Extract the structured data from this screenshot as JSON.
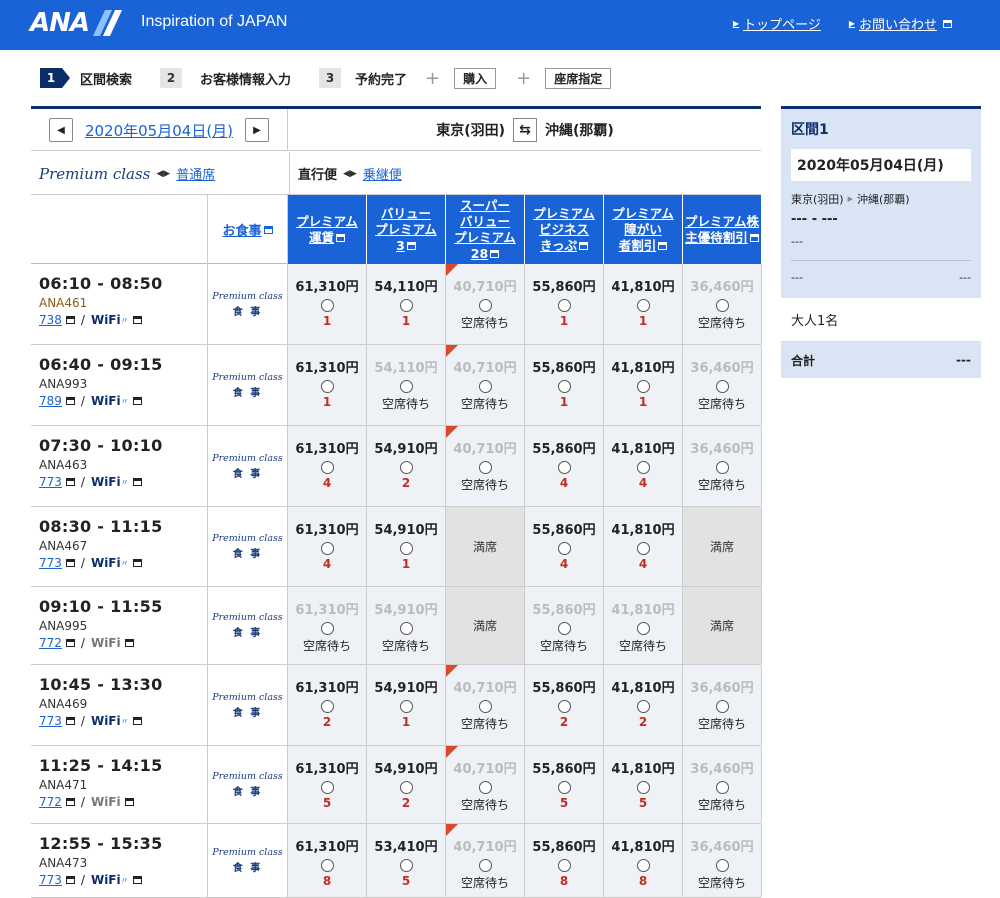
{
  "header": {
    "logo": "ANA",
    "tagline": "Inspiration of JAPAN",
    "links": [
      "トップページ",
      "お問い合わせ"
    ]
  },
  "steps": [
    {
      "num": "1",
      "label": "区間検索"
    },
    {
      "num": "2",
      "label": "お客様情報入力"
    },
    {
      "num": "3",
      "label": "予約完了"
    }
  ],
  "step_boxes": [
    "購入",
    "座席指定"
  ],
  "search": {
    "date": "2020年05月04日(月)",
    "from": "東京(羽田)",
    "to": "沖縄(那覇)",
    "premium_label": "Premium class",
    "normal_seat_link": "普通席",
    "direct": "直行便",
    "connecting_link": "乗継便"
  },
  "table_header": {
    "meal": "お食事",
    "fares": [
      [
        "プレミアム",
        "運賃"
      ],
      [
        "バリュー",
        "プレミアム",
        "3"
      ],
      [
        "スーパー",
        "バリュー",
        "プレミアム",
        "28"
      ],
      [
        "プレミアム",
        "ビジネス",
        "きっぷ"
      ],
      [
        "プレミアム",
        "障がい",
        "者割引"
      ],
      [
        "プレミアム株",
        "主優待割引"
      ]
    ]
  },
  "meal_cell": {
    "premium": "Premium class",
    "label": "食 事"
  },
  "labels": {
    "wait": "空席待ち",
    "full": "満席",
    "wifi": "WiFi",
    "slash": "/"
  },
  "flights": [
    {
      "time": "06:10 - 08:50",
      "num": "ANA461",
      "equip": "738",
      "wifi": true,
      "fares": [
        {
          "price": "61,310円",
          "state": "seats",
          "seats": "1"
        },
        {
          "price": "54,110円",
          "state": "seats",
          "seats": "1"
        },
        {
          "price": "40,710円",
          "state": "wait",
          "flag": true
        },
        {
          "price": "55,860円",
          "state": "seats",
          "seats": "1"
        },
        {
          "price": "41,810円",
          "state": "seats",
          "seats": "1"
        },
        {
          "price": "36,460円",
          "state": "wait"
        }
      ]
    },
    {
      "time": "06:40 - 09:15",
      "num": "ANA993",
      "equip": "789",
      "wifi": true,
      "fares": [
        {
          "price": "61,310円",
          "state": "seats",
          "seats": "1"
        },
        {
          "price": "54,110円",
          "state": "wait"
        },
        {
          "price": "40,710円",
          "state": "wait",
          "flag": true
        },
        {
          "price": "55,860円",
          "state": "seats",
          "seats": "1"
        },
        {
          "price": "41,810円",
          "state": "seats",
          "seats": "1"
        },
        {
          "price": "36,460円",
          "state": "wait"
        }
      ]
    },
    {
      "time": "07:30 - 10:10",
      "num": "ANA463",
      "equip": "773",
      "wifi": true,
      "fares": [
        {
          "price": "61,310円",
          "state": "seats",
          "seats": "4"
        },
        {
          "price": "54,910円",
          "state": "seats",
          "seats": "2"
        },
        {
          "price": "40,710円",
          "state": "wait",
          "flag": true
        },
        {
          "price": "55,860円",
          "state": "seats",
          "seats": "4"
        },
        {
          "price": "41,810円",
          "state": "seats",
          "seats": "4"
        },
        {
          "price": "36,460円",
          "state": "wait"
        }
      ]
    },
    {
      "time": "08:30 - 11:15",
      "num": "ANA467",
      "equip": "773",
      "wifi": true,
      "fares": [
        {
          "price": "61,310円",
          "state": "seats",
          "seats": "4"
        },
        {
          "price": "54,910円",
          "state": "seats",
          "seats": "1"
        },
        {
          "state": "full"
        },
        {
          "price": "55,860円",
          "state": "seats",
          "seats": "4"
        },
        {
          "price": "41,810円",
          "state": "seats",
          "seats": "4"
        },
        {
          "state": "full"
        }
      ]
    },
    {
      "time": "09:10 - 11:55",
      "num": "ANA995",
      "equip": "772",
      "wifi": false,
      "fares": [
        {
          "price": "61,310円",
          "state": "wait"
        },
        {
          "price": "54,910円",
          "state": "wait"
        },
        {
          "state": "full"
        },
        {
          "price": "55,860円",
          "state": "wait"
        },
        {
          "price": "41,810円",
          "state": "wait"
        },
        {
          "state": "full"
        }
      ]
    },
    {
      "time": "10:45 - 13:30",
      "num": "ANA469",
      "equip": "773",
      "wifi": true,
      "fares": [
        {
          "price": "61,310円",
          "state": "seats",
          "seats": "2"
        },
        {
          "price": "54,910円",
          "state": "seats",
          "seats": "1"
        },
        {
          "price": "40,710円",
          "state": "wait",
          "flag": true
        },
        {
          "price": "55,860円",
          "state": "seats",
          "seats": "2"
        },
        {
          "price": "41,810円",
          "state": "seats",
          "seats": "2"
        },
        {
          "price": "36,460円",
          "state": "wait"
        }
      ]
    },
    {
      "time": "11:25 - 14:15",
      "num": "ANA471",
      "equip": "772",
      "wifi": false,
      "fares": [
        {
          "price": "61,310円",
          "state": "seats",
          "seats": "5"
        },
        {
          "price": "54,910円",
          "state": "seats",
          "seats": "2"
        },
        {
          "price": "40,710円",
          "state": "wait",
          "flag": true
        },
        {
          "price": "55,860円",
          "state": "seats",
          "seats": "5"
        },
        {
          "price": "41,810円",
          "state": "seats",
          "seats": "5"
        },
        {
          "price": "36,460円",
          "state": "wait"
        }
      ]
    },
    {
      "time": "12:55 - 15:35",
      "num": "ANA473",
      "equip": "773",
      "wifi": true,
      "fares": [
        {
          "price": "61,310円",
          "state": "seats",
          "seats": "8"
        },
        {
          "price": "53,410円",
          "state": "seats",
          "seats": "5"
        },
        {
          "price": "40,710円",
          "state": "wait",
          "flag": true
        },
        {
          "price": "55,860円",
          "state": "seats",
          "seats": "8"
        },
        {
          "price": "41,810円",
          "state": "seats",
          "seats": "8"
        },
        {
          "price": "36,460円",
          "state": "wait"
        }
      ]
    }
  ],
  "sidebar": {
    "title": "区間1",
    "date": "2020年05月04日(月)",
    "from": "東京(羽田)",
    "to": "沖縄(那覇)",
    "flight_placeholder": "--- - ---",
    "dash": "---",
    "row_left": "---",
    "row_right": "---",
    "pax": "大人1名",
    "total_label": "合計",
    "total_value": "---"
  },
  "colors": {
    "brand": "#1a63d6",
    "navy": "#0b2e6b",
    "seat_count": "#c03020",
    "flag": "#d94a2a"
  }
}
